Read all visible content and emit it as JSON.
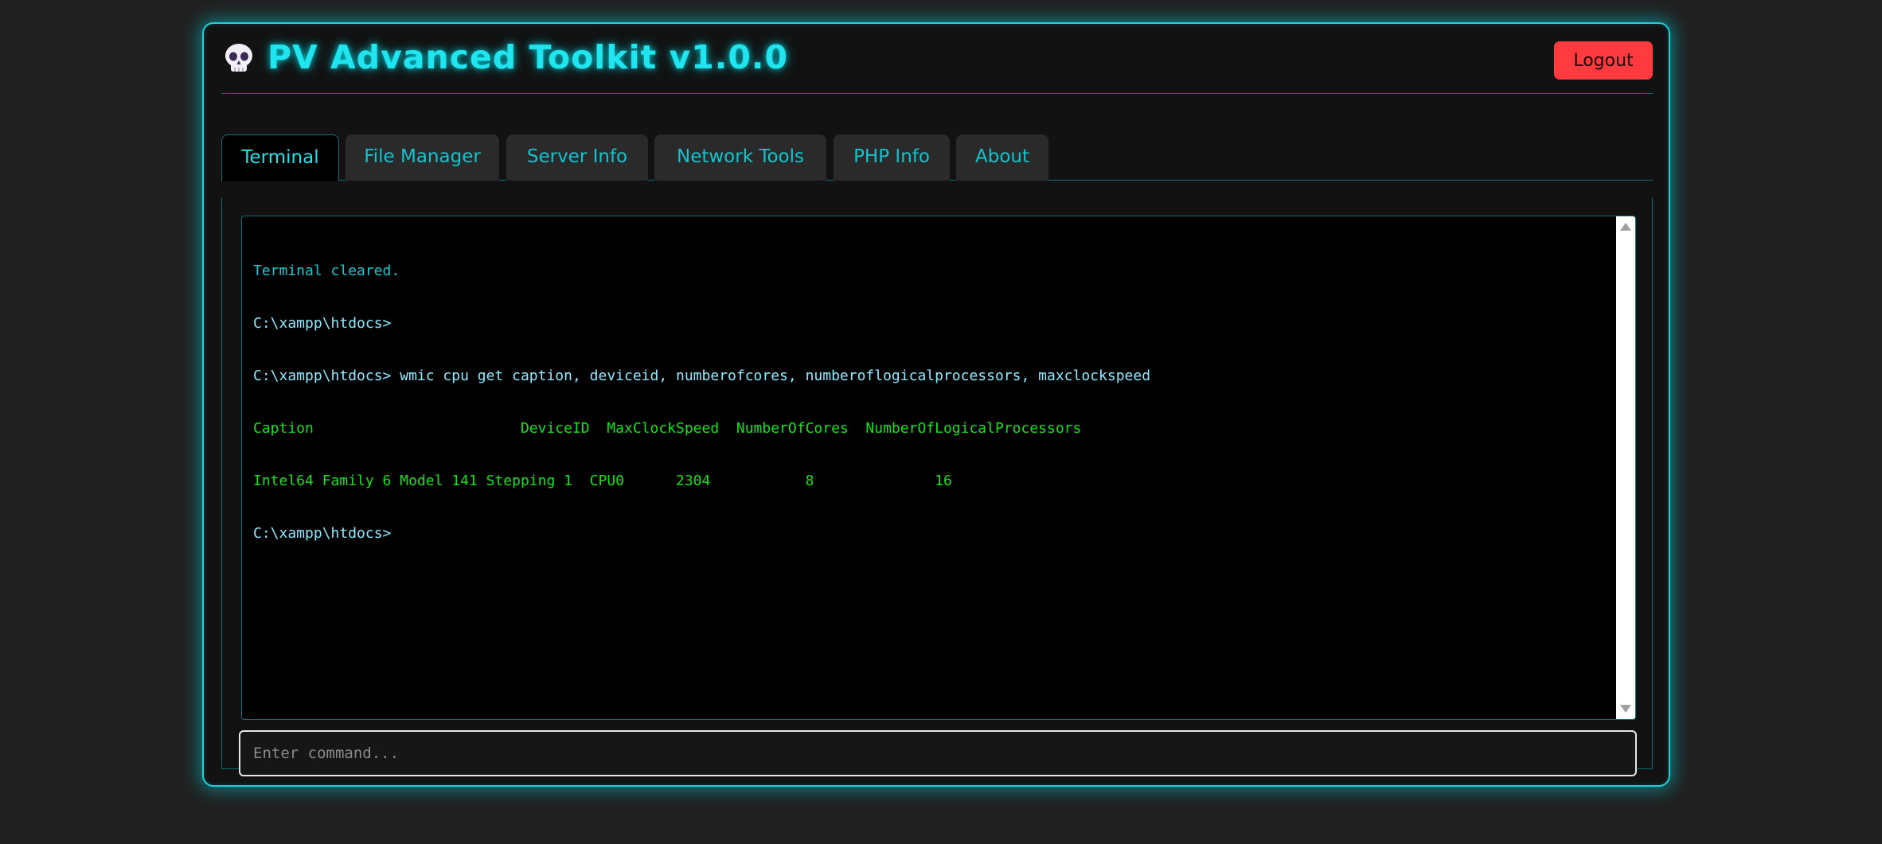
{
  "header": {
    "title": "PV Advanced Toolkit v1.0.0",
    "logout_label": "Logout",
    "logo_icon": "skull-icon"
  },
  "tabs": [
    {
      "label": "Terminal",
      "active": true
    },
    {
      "label": "File Manager",
      "active": false
    },
    {
      "label": "Server Info",
      "active": false
    },
    {
      "label": "Network Tools",
      "active": false
    },
    {
      "label": "PHP Info",
      "active": false
    },
    {
      "label": "About",
      "active": false
    }
  ],
  "terminal": {
    "lines": [
      {
        "type": "info",
        "text": "Terminal cleared."
      },
      {
        "type": "prompt",
        "text": "C:\\xampp\\htdocs>"
      },
      {
        "type": "prompt",
        "text": "C:\\xampp\\htdocs> wmic cpu get caption, deviceid, numberofcores, numberoflogicalprocessors, maxclockspeed"
      },
      {
        "type": "output",
        "text": "Caption                        DeviceID  MaxClockSpeed  NumberOfCores  NumberOfLogicalProcessors"
      },
      {
        "type": "output",
        "text": "Intel64 Family 6 Model 141 Stepping 1  CPU0      2304           8              16"
      },
      {
        "type": "prompt",
        "text": "C:\\xampp\\htdocs>"
      }
    ],
    "input_placeholder": "Enter command...",
    "input_value": ""
  },
  "colors": {
    "accent": "#1fd0d8",
    "title": "#20e4ee",
    "logout_bg": "#ff3b3f",
    "output_green": "#14e21a",
    "prompt": "#8fe9ff"
  }
}
